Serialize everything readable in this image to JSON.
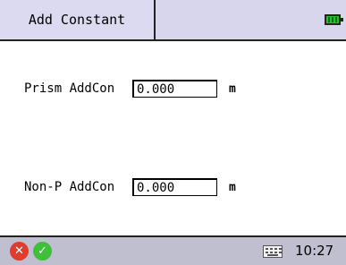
{
  "title": "Add Constant",
  "fields": [
    {
      "label": "Prism AddCon",
      "value": "0.000",
      "unit": "m"
    },
    {
      "label": "Non-P AddCon",
      "value": "0.000",
      "unit": "m"
    }
  ],
  "status": {
    "time": "10:27",
    "cancel_icon": "✕",
    "ok_icon": "✓"
  },
  "colors": {
    "title_bg": "#d8d6ec",
    "status_bg": "#c0bfcf",
    "battery": "#27c12f"
  }
}
